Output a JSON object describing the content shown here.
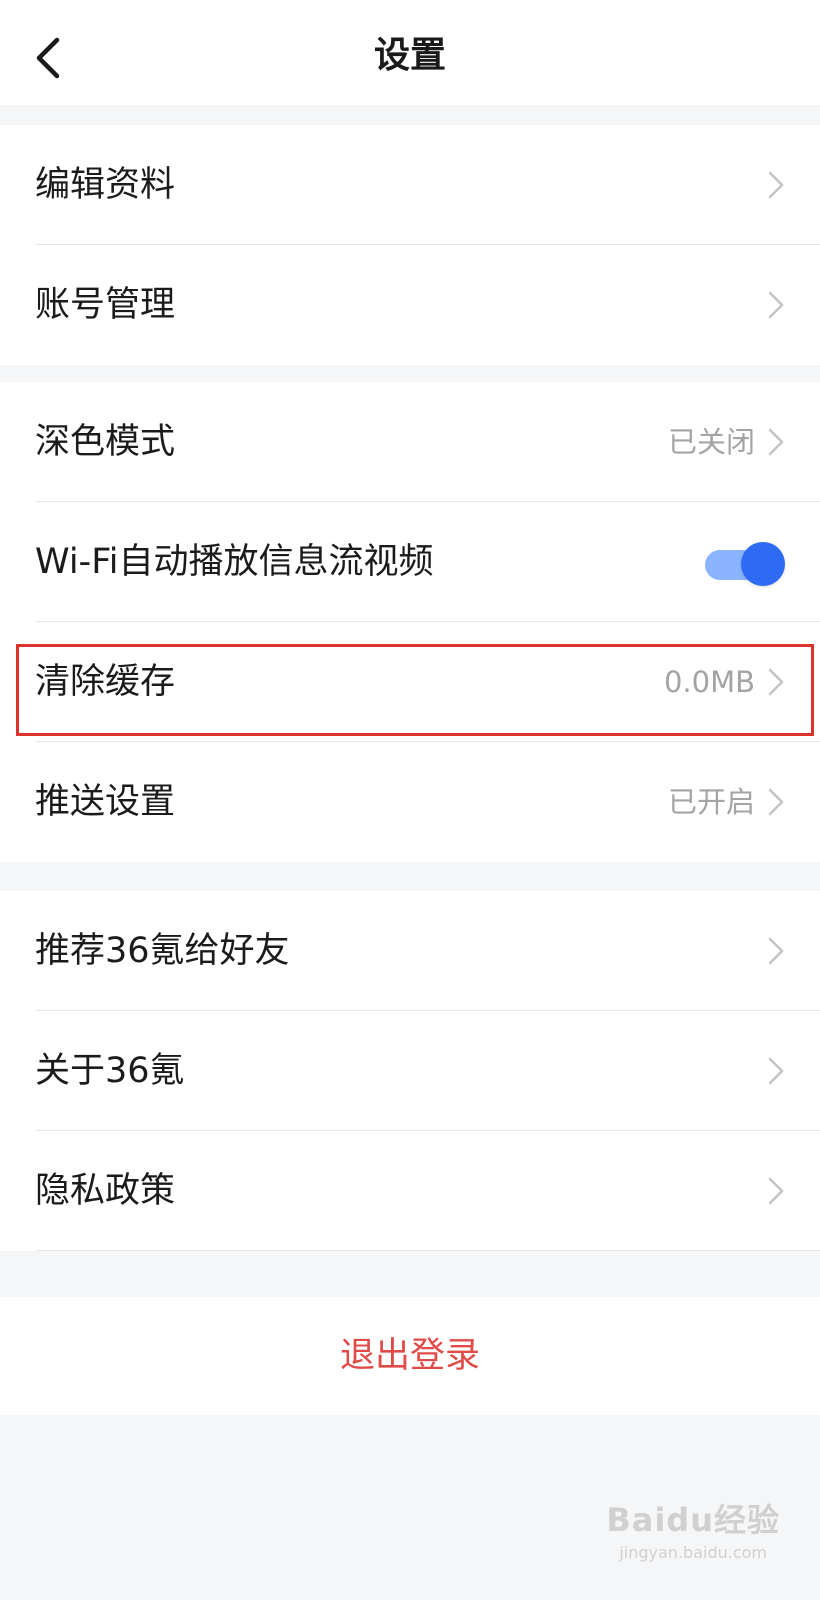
{
  "header": {
    "title": "设置",
    "back_icon": "chevron-left-icon"
  },
  "groups": [
    {
      "items": [
        {
          "label": "编辑资料",
          "value": ""
        },
        {
          "label": "账号管理",
          "value": ""
        }
      ]
    },
    {
      "items": [
        {
          "label": "深色模式",
          "value": "已关闭"
        },
        {
          "label": "Wi-Fi自动播放信息流视频",
          "toggle": true
        },
        {
          "label": "清除缓存",
          "value": "0.0MB"
        },
        {
          "label": "推送设置",
          "value": "已开启"
        }
      ]
    },
    {
      "items": [
        {
          "label": "推荐36氪给好友",
          "value": ""
        },
        {
          "label": "关于36氪",
          "value": ""
        },
        {
          "label": "隐私政策",
          "value": ""
        }
      ]
    }
  ],
  "logout": {
    "label": "退出登录"
  },
  "watermark": {
    "logo": "Baidu经验",
    "url": "jingyan.baidu.com"
  },
  "colors": {
    "accent": "#2f6bf2",
    "toggle_track": "#8ab4ff",
    "logout": "#e04b48",
    "highlight": "#e0322c",
    "background": "#f5f6f8"
  }
}
